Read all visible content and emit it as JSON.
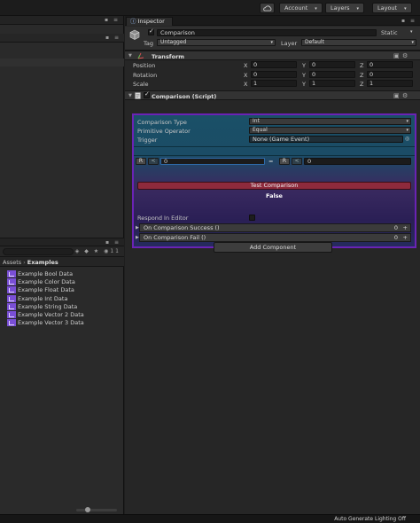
{
  "toolbar": {
    "account": "Account",
    "layers": "Layers",
    "layout": "Layout"
  },
  "project": {
    "asset_count": "11",
    "breadcrumb_root": "Assets",
    "breadcrumb_current": "Examples",
    "assets": [
      "Example Bool Data",
      "Example Color Data",
      "Example Float Data",
      "Example Int Data",
      "Example String Data",
      "Example Vector 2 Data",
      "Example Vector 3 Data"
    ]
  },
  "inspector": {
    "tab_label": "Inspector",
    "object_name": "Comparison",
    "static_label": "Static",
    "tag_label": "Tag",
    "tag_value": "Untagged",
    "layer_label": "Layer",
    "layer_value": "Default",
    "transform": {
      "title": "Transform",
      "rows": [
        {
          "label": "Position",
          "x": "0",
          "y": "0",
          "z": "0"
        },
        {
          "label": "Rotation",
          "x": "0",
          "y": "0",
          "z": "0"
        },
        {
          "label": "Scale",
          "x": "1",
          "y": "1",
          "z": "1"
        }
      ],
      "axis_x": "X",
      "axis_y": "Y",
      "axis_z": "Z"
    },
    "script": {
      "title": "Comparison (Script)",
      "comparison_type_label": "Comparison Type",
      "comparison_type_value": "Int",
      "primitive_operator_label": "Primitive Operator",
      "primitive_operator_value": "Equal",
      "trigger_label": "Trigger",
      "trigger_value": "None (Game Event)",
      "left_ref": "R",
      "left_value": "0",
      "operator_symbol": "=",
      "right_ref": "R",
      "right_value": "0",
      "test_button": "Test Comparison",
      "result": "False",
      "respond_label": "Respond In Editor",
      "events": [
        {
          "label": "On Comparison Success ()",
          "count": "0",
          "add": "+"
        },
        {
          "label": "On Comparison Fail ()",
          "count": "0",
          "add": "+"
        }
      ]
    },
    "add_component": "Add Component"
  },
  "status": {
    "text": "Auto Generate Lighting Off"
  },
  "colors": {
    "accent_purple": "#6a23b5",
    "test_button": "#8e2a3c",
    "body_teal": "#1a5067"
  }
}
